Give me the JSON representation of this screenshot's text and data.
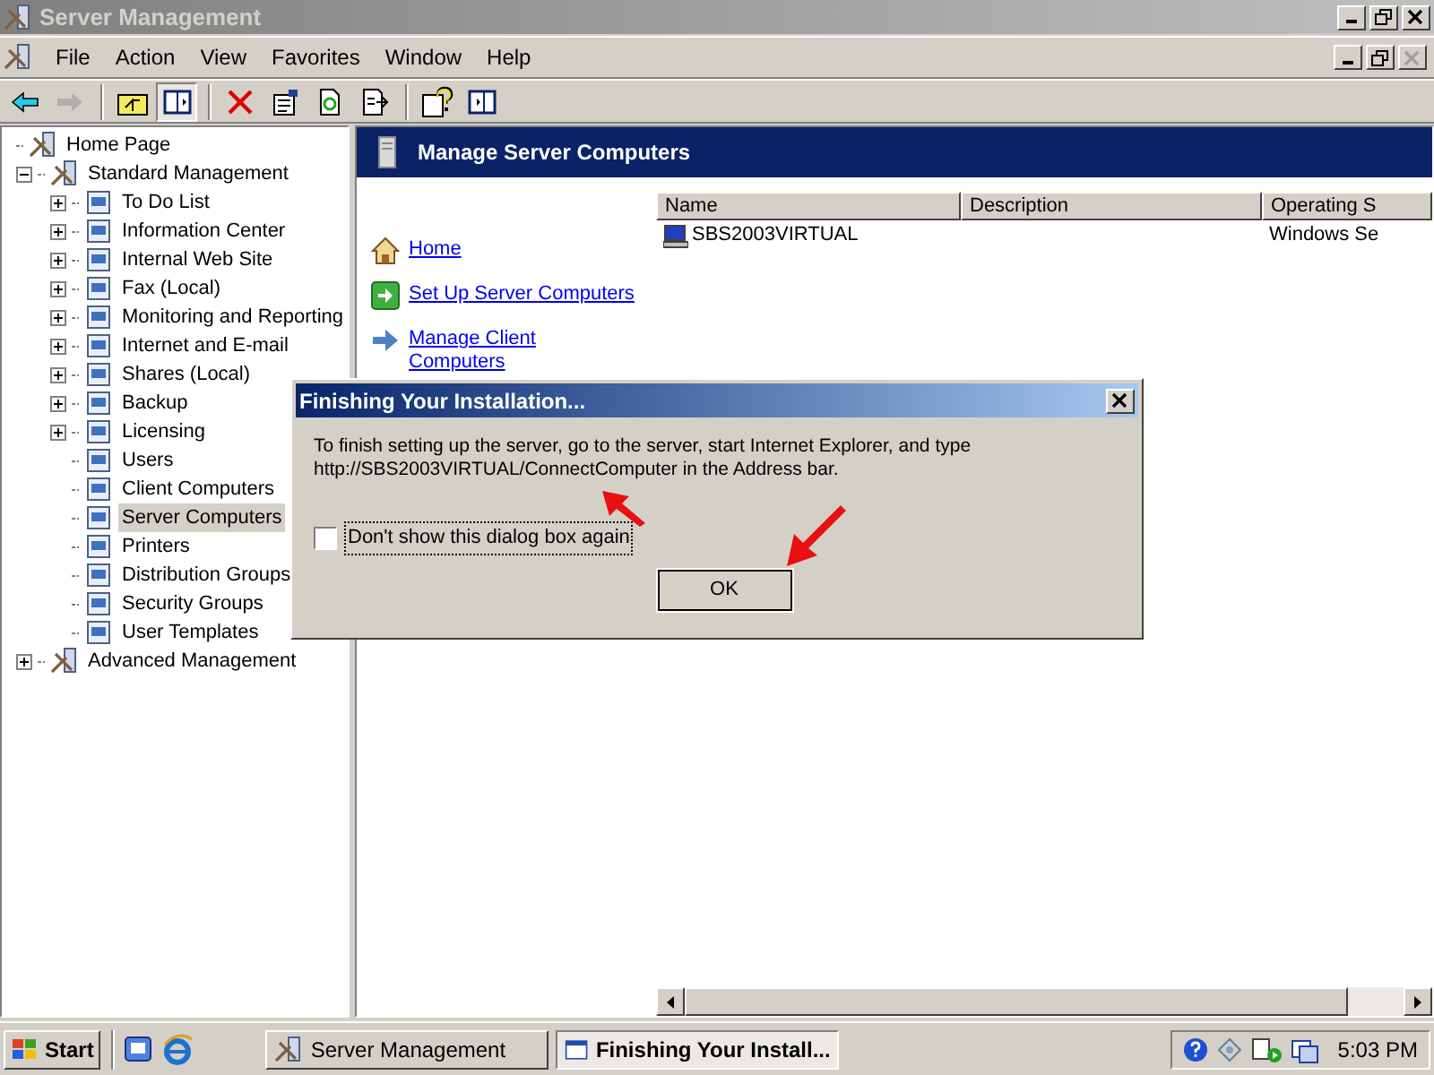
{
  "window": {
    "title": "Server Management"
  },
  "menu": [
    "File",
    "Action",
    "View",
    "Favorites",
    "Window",
    "Help"
  ],
  "toolbar": [
    {
      "kind": "back",
      "disabled": false,
      "pressed": false
    },
    {
      "kind": "forward",
      "disabled": true,
      "pressed": false
    },
    {
      "kind": "up",
      "disabled": false,
      "pressed": false
    },
    {
      "kind": "tree",
      "disabled": false,
      "pressed": true
    },
    {
      "kind": "delete",
      "disabled": false,
      "pressed": false
    },
    {
      "kind": "properties",
      "disabled": false,
      "pressed": false
    },
    {
      "kind": "refresh",
      "disabled": false,
      "pressed": false
    },
    {
      "kind": "export",
      "disabled": false,
      "pressed": false
    },
    {
      "kind": "help",
      "disabled": false,
      "pressed": false
    },
    {
      "kind": "view",
      "disabled": false,
      "pressed": false
    }
  ],
  "tree": [
    {
      "label": "Home Page",
      "kind": "leaf",
      "selected": false
    },
    {
      "label": "Standard Management",
      "kind": "branch",
      "expanded": true,
      "selected": false,
      "children": [
        {
          "label": "To Do List",
          "kind": "branch",
          "expanded": false,
          "selected": false
        },
        {
          "label": "Information Center",
          "kind": "branch",
          "expanded": false,
          "selected": false
        },
        {
          "label": "Internal Web Site",
          "kind": "branch",
          "expanded": false,
          "selected": false
        },
        {
          "label": "Fax (Local)",
          "kind": "branch",
          "expanded": false,
          "selected": false
        },
        {
          "label": "Monitoring and Reporting",
          "kind": "branch",
          "expanded": false,
          "selected": false
        },
        {
          "label": "Internet and E-mail",
          "kind": "branch",
          "expanded": false,
          "selected": false
        },
        {
          "label": "Shares (Local)",
          "kind": "branch",
          "expanded": false,
          "selected": false
        },
        {
          "label": "Backup",
          "kind": "branch",
          "expanded": false,
          "selected": false
        },
        {
          "label": "Licensing",
          "kind": "branch",
          "expanded": false,
          "selected": false
        },
        {
          "label": "Users",
          "kind": "leaf",
          "selected": false
        },
        {
          "label": "Client Computers",
          "kind": "leaf",
          "selected": false
        },
        {
          "label": "Server Computers",
          "kind": "leaf",
          "selected": true
        },
        {
          "label": "Printers",
          "kind": "leaf",
          "selected": false
        },
        {
          "label": "Distribution Groups",
          "kind": "leaf",
          "selected": false
        },
        {
          "label": "Security Groups",
          "kind": "leaf",
          "selected": false
        },
        {
          "label": "User Templates",
          "kind": "leaf",
          "selected": false
        }
      ]
    },
    {
      "label": "Advanced Management",
      "kind": "branch",
      "expanded": false,
      "selected": false
    }
  ],
  "panel": {
    "title": "Manage Server Computers",
    "links": [
      {
        "label": "Home",
        "kind": "home"
      },
      {
        "label": "Set Up Server Computers",
        "kind": "setup"
      },
      {
        "label": "Manage Client\nComputers",
        "kind": "arrow"
      }
    ]
  },
  "table": {
    "columns": [
      "Name",
      "Description",
      "Operating S"
    ],
    "rows": [
      [
        "SBS2003VIRTUAL",
        "",
        "Windows Se"
      ]
    ]
  },
  "dialog": {
    "title": "Finishing Your Installation...",
    "message": "To finish setting up the server, go to the server, start Internet Explorer, and type\nhttp://SBS2003VIRTUAL/ConnectComputer in the Address bar.",
    "checkbox": {
      "label": "Don't show this dialog box again",
      "checked": false
    },
    "button": "OK"
  },
  "taskbar": {
    "start": "Start",
    "tasks": [
      {
        "label": "Server Management",
        "selected": false
      },
      {
        "label": "Finishing Your Install...",
        "selected": true
      }
    ],
    "clock": "5:03 PM"
  }
}
